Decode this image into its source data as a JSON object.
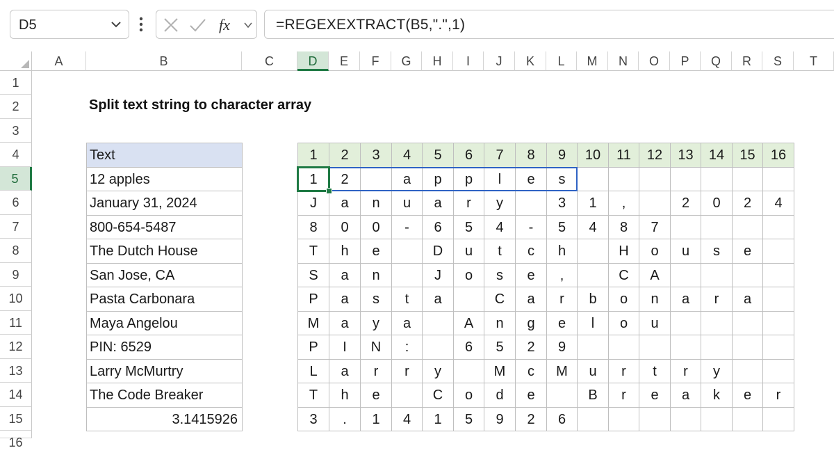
{
  "formula_bar": {
    "name_box": "D5",
    "formula": "=REGEXEXTRACT(B5,\".\",1)",
    "icons": [
      "chevron-down-icon",
      "more-options-icon",
      "cancel-icon",
      "enter-icon",
      "insert-function-icon"
    ]
  },
  "columns": [
    "A",
    "B",
    "C",
    "D",
    "E",
    "F",
    "G",
    "H",
    "I",
    "J",
    "K",
    "L",
    "M",
    "N",
    "O",
    "P",
    "Q",
    "R",
    "S",
    "T"
  ],
  "rows": [
    "1",
    "2",
    "3",
    "4",
    "5",
    "6",
    "7",
    "8",
    "9",
    "10",
    "11",
    "12",
    "13",
    "14",
    "15",
    "16"
  ],
  "active_cell": "D5",
  "sheet": {
    "title": "Split text string to character array",
    "text_header": "Text",
    "texts": [
      "12 apples",
      "January 31, 2024",
      "800-654-5487",
      "The Dutch House",
      "San Jose, CA",
      "Pasta Carbonara",
      "Maya Angelou",
      "PIN: 6529",
      "Larry McMurtry",
      "The Code Breaker",
      "3.1415926"
    ],
    "index_headers": [
      "1",
      "2",
      "3",
      "4",
      "5",
      "6",
      "7",
      "8",
      "9",
      "10",
      "11",
      "12",
      "13",
      "14",
      "15",
      "16"
    ],
    "chars": [
      [
        "1",
        "2",
        " ",
        "a",
        "p",
        "p",
        "l",
        "e",
        "s",
        "",
        "",
        "",
        "",
        "",
        "",
        ""
      ],
      [
        "J",
        "a",
        "n",
        "u",
        "a",
        "r",
        "y",
        " ",
        "3",
        "1",
        ",",
        " ",
        "2",
        "0",
        "2",
        "4"
      ],
      [
        "8",
        "0",
        "0",
        "-",
        "6",
        "5",
        "4",
        "-",
        "5",
        "4",
        "8",
        "7",
        "",
        "",
        "",
        ""
      ],
      [
        "T",
        "h",
        "e",
        " ",
        "D",
        "u",
        "t",
        "c",
        "h",
        " ",
        "H",
        "o",
        "u",
        "s",
        "e",
        ""
      ],
      [
        "S",
        "a",
        "n",
        " ",
        "J",
        "o",
        "s",
        "e",
        ",",
        " ",
        "C",
        "A",
        "",
        "",
        "",
        ""
      ],
      [
        "P",
        "a",
        "s",
        "t",
        "a",
        " ",
        "C",
        "a",
        "r",
        "b",
        "o",
        "n",
        "a",
        "r",
        "a",
        ""
      ],
      [
        "M",
        "a",
        "y",
        "a",
        " ",
        "A",
        "n",
        "g",
        "e",
        "l",
        "o",
        "u",
        "",
        "",
        "",
        ""
      ],
      [
        "P",
        "I",
        "N",
        ":",
        " ",
        "6",
        "5",
        "2",
        "9",
        "",
        "",
        "",
        "",
        "",
        "",
        ""
      ],
      [
        "L",
        "a",
        "r",
        "r",
        "y",
        " ",
        "M",
        "c",
        "M",
        "u",
        "r",
        "t",
        "r",
        "y",
        "",
        ""
      ],
      [
        "T",
        "h",
        "e",
        " ",
        "C",
        "o",
        "d",
        "e",
        " ",
        "B",
        "r",
        "e",
        "a",
        "k",
        "e",
        "r"
      ],
      [
        "3",
        ".",
        "1",
        "4",
        "1",
        "5",
        "9",
        "2",
        "6",
        "",
        "",
        "",
        "",
        "",
        "",
        ""
      ]
    ]
  },
  "colors": {
    "selected_header_bg": "#d3e6d7",
    "active_border": "#1f7a44",
    "spill_border": "#2f63c4",
    "text_header_bg": "#d9e1f2",
    "index_header_bg": "#e2efda"
  }
}
